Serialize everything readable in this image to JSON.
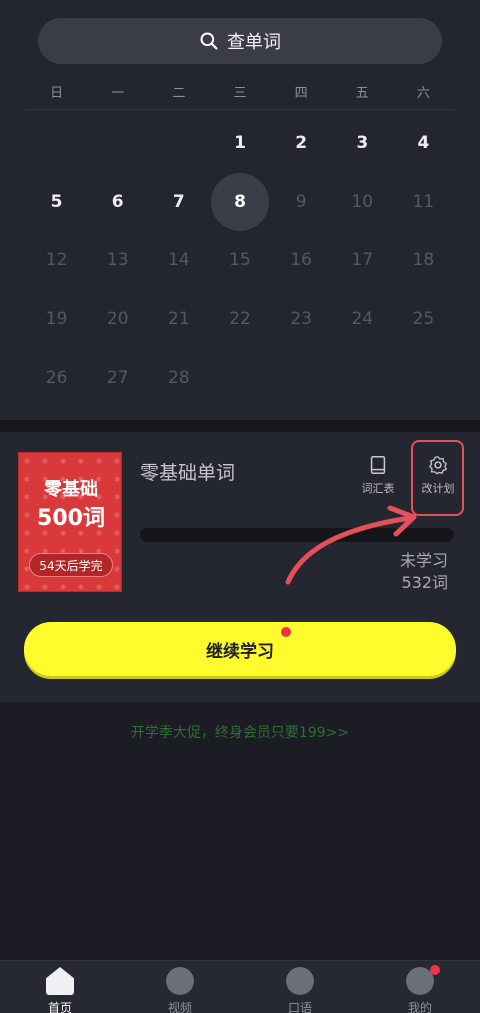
{
  "search": {
    "label": "查单词"
  },
  "calendar": {
    "weekdays": [
      "日",
      "一",
      "二",
      "三",
      "四",
      "五",
      "六"
    ],
    "days": [
      {
        "n": "",
        "state": "empty"
      },
      {
        "n": "",
        "state": "empty"
      },
      {
        "n": "",
        "state": "empty"
      },
      {
        "n": "1",
        "state": "past"
      },
      {
        "n": "2",
        "state": "past"
      },
      {
        "n": "3",
        "state": "past"
      },
      {
        "n": "4",
        "state": "past"
      },
      {
        "n": "5",
        "state": "past"
      },
      {
        "n": "6",
        "state": "past"
      },
      {
        "n": "7",
        "state": "past"
      },
      {
        "n": "8",
        "state": "today"
      },
      {
        "n": "9",
        "state": "future"
      },
      {
        "n": "10",
        "state": "future"
      },
      {
        "n": "11",
        "state": "future"
      },
      {
        "n": "12",
        "state": "future"
      },
      {
        "n": "13",
        "state": "future"
      },
      {
        "n": "14",
        "state": "future"
      },
      {
        "n": "15",
        "state": "future"
      },
      {
        "n": "16",
        "state": "future"
      },
      {
        "n": "17",
        "state": "future"
      },
      {
        "n": "18",
        "state": "future"
      },
      {
        "n": "19",
        "state": "future"
      },
      {
        "n": "20",
        "state": "future"
      },
      {
        "n": "21",
        "state": "future"
      },
      {
        "n": "22",
        "state": "future"
      },
      {
        "n": "23",
        "state": "future"
      },
      {
        "n": "24",
        "state": "future"
      },
      {
        "n": "25",
        "state": "future"
      },
      {
        "n": "26",
        "state": "future"
      },
      {
        "n": "27",
        "state": "future"
      },
      {
        "n": "28",
        "state": "future"
      }
    ]
  },
  "plan": {
    "book_line1": "零基础",
    "book_line2": "500词",
    "book_badge": "54天后学完",
    "name": "零基础单词",
    "vocab_label": "词汇表",
    "plan_label": "改计划",
    "progress": 0,
    "unlearned_label": "未学习",
    "unlearned_count": "532词"
  },
  "continue_label": "继续学习",
  "promo": "开学季大促，终身会员只要199>>",
  "tabs": [
    {
      "label": "首页",
      "icon": "home-icon",
      "active": true
    },
    {
      "label": "视频",
      "icon": "video-icon",
      "active": false
    },
    {
      "label": "口语",
      "icon": "speech-icon",
      "active": false
    },
    {
      "label": "我的",
      "icon": "profile-icon",
      "active": false
    }
  ],
  "colors": {
    "accent_yellow": "#fffb2c",
    "highlight_red": "#e5505a",
    "book_red": "#d9393a"
  }
}
